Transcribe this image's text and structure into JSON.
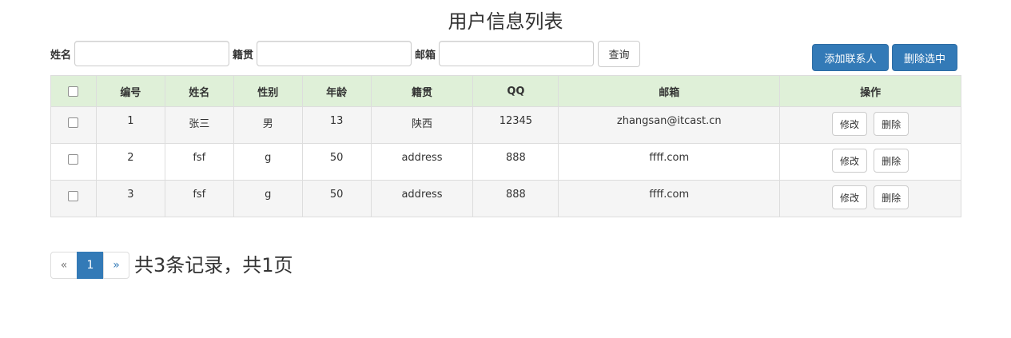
{
  "page": {
    "title": "用户信息列表"
  },
  "search": {
    "name_label": "姓名",
    "name_value": "",
    "address_label": "籍贯",
    "address_value": "",
    "email_label": "邮箱",
    "email_value": "",
    "query_button": "查询"
  },
  "actions": {
    "add_contact": "添加联系人",
    "delete_selected": "删除选中"
  },
  "table": {
    "headers": [
      "编号",
      "姓名",
      "性别",
      "年龄",
      "籍贯",
      "QQ",
      "邮箱",
      "操作"
    ],
    "edit_label": "修改",
    "delete_label": "删除",
    "rows": [
      {
        "id": "1",
        "name": "张三",
        "gender": "男",
        "age": "13",
        "address": "陕西",
        "qq": "12345",
        "email": "zhangsan@itcast.cn"
      },
      {
        "id": "2",
        "name": "fsf",
        "gender": "g",
        "age": "50",
        "address": "address",
        "qq": "888",
        "email": "ffff.com"
      },
      {
        "id": "3",
        "name": "fsf",
        "gender": "g",
        "age": "50",
        "address": "address",
        "qq": "888",
        "email": "ffff.com"
      }
    ]
  },
  "pagination": {
    "prev": "«",
    "pages": [
      "1"
    ],
    "current_page": "1",
    "next": "»",
    "summary": "共3条记录，共1页"
  },
  "colors": {
    "primary": "#337ab7",
    "header_bg": "#dff0d8",
    "stripe_bg": "#f5f5f5"
  }
}
